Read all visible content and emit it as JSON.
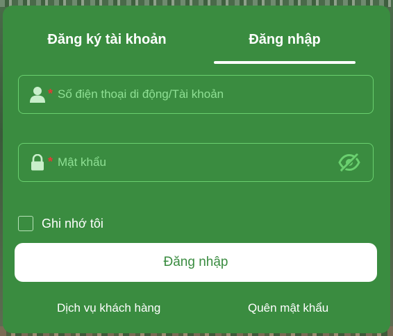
{
  "tabs": {
    "register_label": "Đăng ký tài khoản",
    "login_label": "Đăng nhập",
    "active": "login"
  },
  "form": {
    "phone": {
      "icon": "user-icon",
      "required_mark": "*",
      "placeholder": "Số điện thoại di động/Tài khoản",
      "value": ""
    },
    "password": {
      "icon": "lock-icon",
      "required_mark": "*",
      "placeholder": "Mật khẩu",
      "value": "",
      "toggle_icon": "eye-slash-icon"
    },
    "remember_label": "Ghi nhớ tôi",
    "remember_checked": false,
    "submit_label": "Đăng nhập"
  },
  "footer": {
    "support_label": "Dịch vụ khách hàng",
    "forgot_label": "Quên mật khẩu"
  },
  "colors": {
    "panel": "#3a8c40",
    "field_border": "#6ad06f",
    "placeholder": "#8fe094",
    "required": "#e53935",
    "button_bg": "#ffffff",
    "button_text": "#3a8c40"
  }
}
